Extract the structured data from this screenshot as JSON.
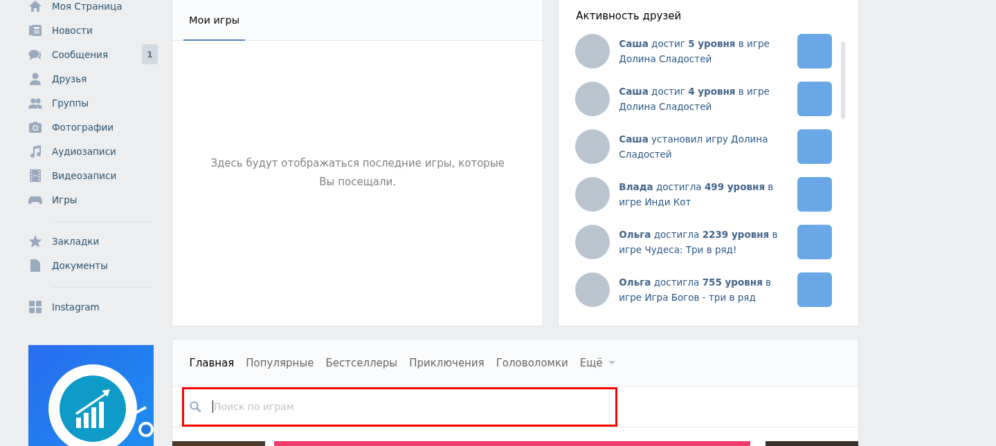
{
  "sidebar": {
    "groups": [
      [
        {
          "label": "Моя Страница"
        },
        {
          "label": "Новости"
        },
        {
          "label": "Сообщения",
          "badge": "1"
        },
        {
          "label": "Друзья"
        },
        {
          "label": "Группы"
        },
        {
          "label": "Фотографии"
        },
        {
          "label": "Аудиозаписи"
        },
        {
          "label": "Видеозаписи"
        },
        {
          "label": "Игры"
        }
      ],
      [
        {
          "label": "Закладки"
        },
        {
          "label": "Документы"
        }
      ],
      [
        {
          "label": "Instagram"
        }
      ]
    ]
  },
  "my_games": {
    "tabs": [
      {
        "label": "Мои игры",
        "selected": true
      }
    ],
    "empty_text": "Здесь будут отображаться последние игры, которые Вы посещали."
  },
  "friends_activity": {
    "title": "Активность друзей",
    "items": [
      {
        "text": "**Саша** достиг **5 уровня** в игре Долина Сладостей"
      },
      {
        "text": "**Саша** достиг **4 уровня** в игре Долина Сладостей"
      },
      {
        "text": "**Саша** установил игру Долина Сладостей"
      },
      {
        "text": "**Влада** достигла **499 уровня** в игре Инди Кот"
      },
      {
        "text": "**Ольга** достигла **2239 уровня** в игре Чудеса: Три в ряд!"
      },
      {
        "text": "**Ольга** достигла **755 уровня** в игре Игра Богов - три в ряд"
      }
    ]
  },
  "catalog": {
    "tabs": [
      {
        "label": "Главная",
        "selected": true
      },
      {
        "label": "Популярные",
        "selected": false
      },
      {
        "label": "Бестселлеры",
        "selected": false
      },
      {
        "label": "Приключения",
        "selected": false
      },
      {
        "label": "Головоломки",
        "selected": false
      },
      {
        "label": "Ещё",
        "selected": false,
        "kind": "dropdown"
      }
    ],
    "search": {
      "placeholder": "Поиск по играм",
      "highlighted": true
    }
  }
}
